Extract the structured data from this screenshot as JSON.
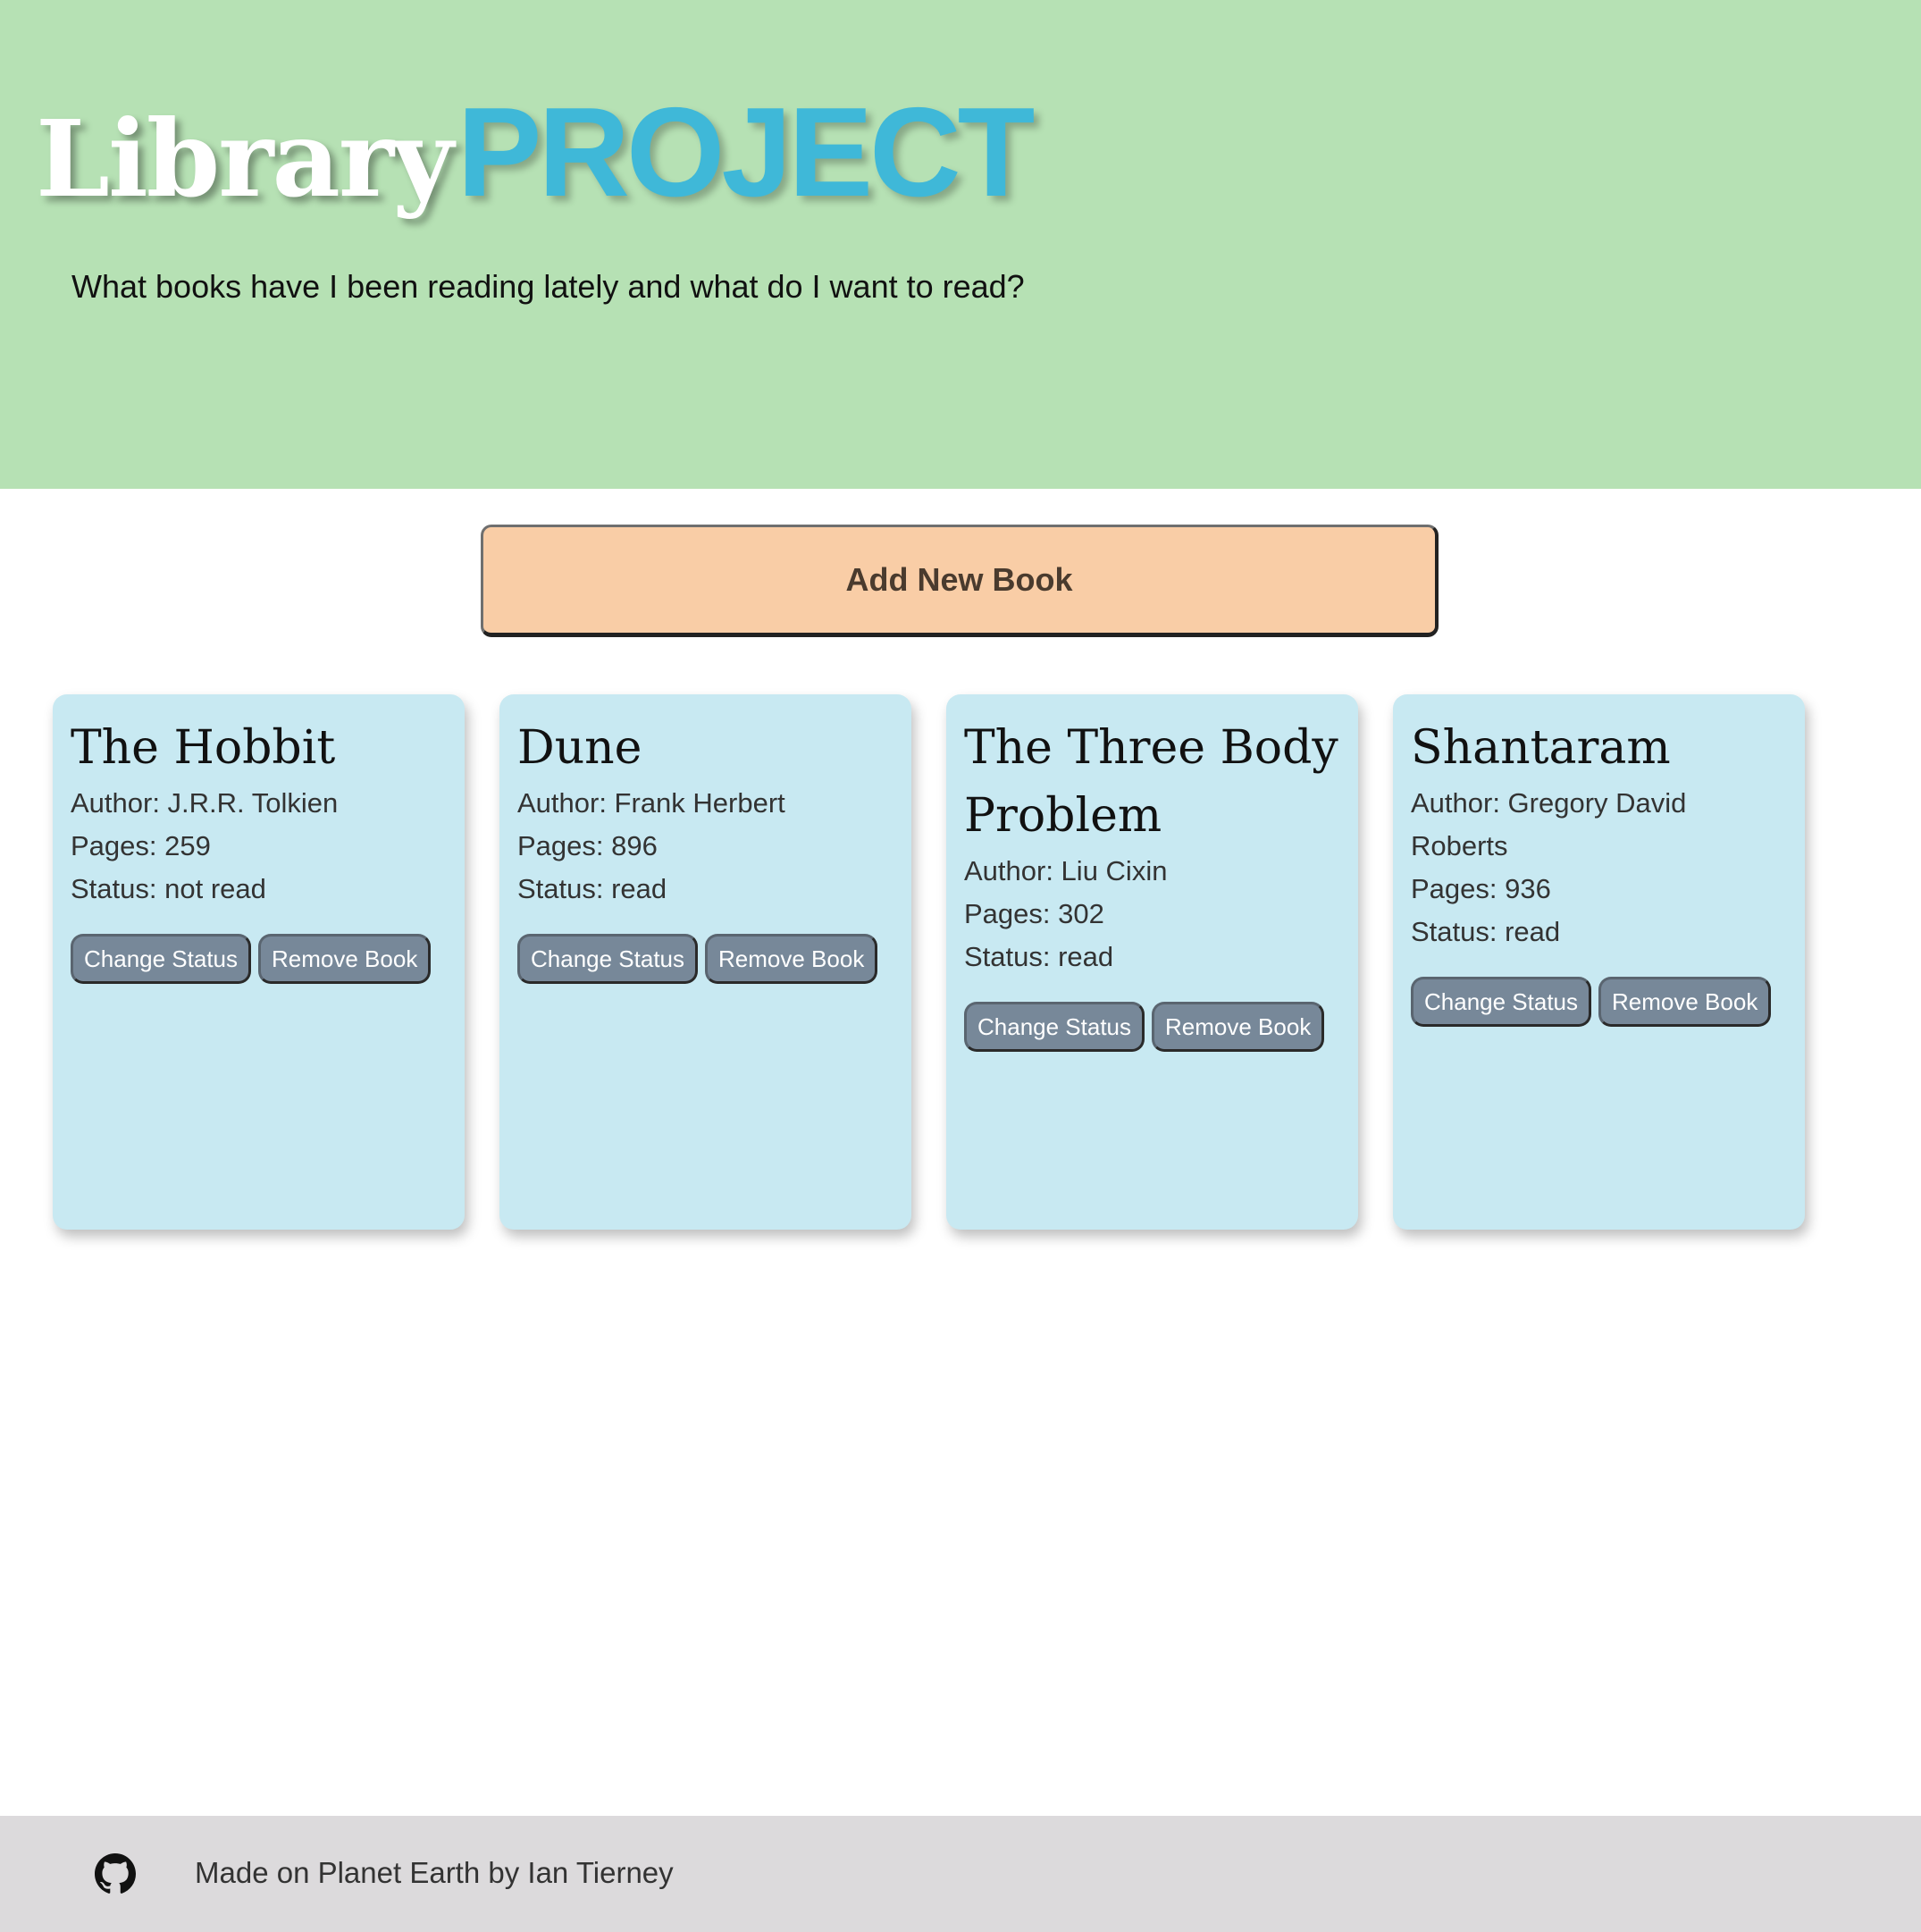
{
  "header": {
    "title_main": "Library",
    "title_accent": "PROJECT",
    "subtitle": "What books have I been reading lately and what do I want to read?"
  },
  "actions": {
    "add_book_label": "Add New Book"
  },
  "books": [
    {
      "title": "The Hobbit",
      "author": "Author: J.R.R. Tolkien",
      "pages": "Pages: 259",
      "status": "Status: not read",
      "change_status_label": "Change Status",
      "remove_label": "Remove Book"
    },
    {
      "title": "Dune",
      "author": "Author: Frank Herbert",
      "pages": "Pages: 896",
      "status": "Status: read",
      "change_status_label": "Change Status",
      "remove_label": "Remove Book"
    },
    {
      "title": "The Three Body Problem",
      "author": "Author: Liu Cixin",
      "pages": "Pages: 302",
      "status": "Status: read",
      "change_status_label": "Change Status",
      "remove_label": "Remove Book"
    },
    {
      "title": "Shantaram",
      "author": "Author: Gregory David Roberts",
      "pages": "Pages: 936",
      "status": "Status: read",
      "change_status_label": "Change Status",
      "remove_label": "Remove Book"
    }
  ],
  "footer": {
    "icon": "github-icon",
    "text": "Made on Planet Earth by Ian Tierney"
  },
  "colors": {
    "header_bg": "#b6e1b4",
    "accent": "#3fb8d8",
    "add_button_bg": "#f9cda6",
    "card_bg": "#c8e9f2",
    "card_button_bg": "#778899",
    "footer_bg": "#dcdadc"
  }
}
